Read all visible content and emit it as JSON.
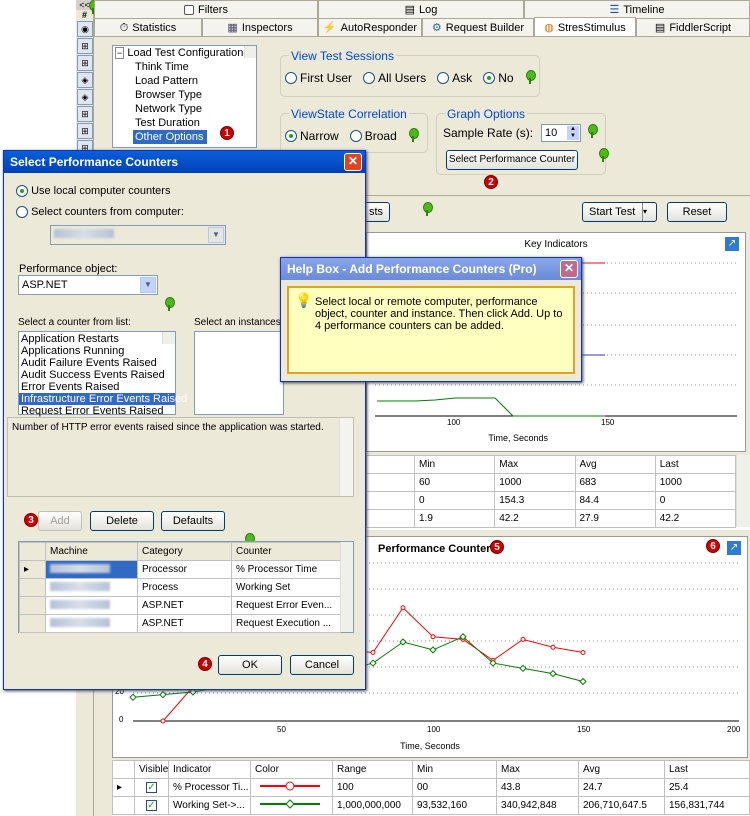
{
  "session_strip": {
    "toggle": "<<",
    "header": "#"
  },
  "top_tabs_row1": [
    {
      "label": "Filters"
    },
    {
      "label": "Log"
    },
    {
      "label": "Timeline"
    }
  ],
  "top_tabs_row2": [
    {
      "label": "Statistics"
    },
    {
      "label": "Inspectors"
    },
    {
      "label": "AutoResponder"
    },
    {
      "label": "Request Builder"
    },
    {
      "label": "StresStimulus",
      "selected": true
    },
    {
      "label": "FiddlerScript"
    }
  ],
  "tree": {
    "root": "Load Test Configuration",
    "items": [
      "Think Time",
      "Load Pattern",
      "Browser Type",
      "Network Type",
      "Test Duration",
      "Other Options"
    ],
    "selected": "Other Options"
  },
  "view_sessions": {
    "title": "View Test Sessions",
    "options": [
      "First User",
      "All Users",
      "Ask",
      "No"
    ],
    "selected": "No"
  },
  "viewstate": {
    "title": "ViewState Correlation",
    "options": [
      "Narrow",
      "Broad"
    ],
    "selected": "Narrow"
  },
  "graph_options": {
    "title": "Graph Options",
    "sample_rate_label": "Sample Rate (s):",
    "sample_rate_value": "10",
    "select_counter_button": "Select  Performance Counter"
  },
  "toolbar": {
    "partial_button": "sts",
    "start_test": "Start Test",
    "reset": "Reset"
  },
  "badges": [
    "1",
    "2",
    "3",
    "4",
    "5",
    "6"
  ],
  "key_chart": {
    "title": "Key Indicators",
    "x_ticks": [
      "100",
      "150"
    ],
    "xlabel": "Time, Seconds"
  },
  "key_table": {
    "headers": [
      "Min",
      "Max",
      "Avg",
      "Last"
    ],
    "rows": [
      [
        "60",
        "1000",
        "683",
        "1000"
      ],
      [
        "0",
        "154.3",
        "84.4",
        "0"
      ],
      [
        "1.9",
        "42.2",
        "27.9",
        "42.2"
      ]
    ]
  },
  "perf_chart": {
    "title": "Performance Counters",
    "xlabel": "Time, Seconds",
    "x_ticks": [
      "50",
      "100",
      "150",
      "200"
    ],
    "y_ticks": [
      "20",
      "0"
    ]
  },
  "chart_data": {
    "type": "line",
    "title": "Performance Counters",
    "xlabel": "Time, Seconds",
    "ylabel": "",
    "xlim": [
      0,
      200
    ],
    "ylim": [
      0,
      60
    ],
    "series": [
      {
        "name": "% Processor Ti...",
        "color": "#ff0000",
        "x": [
          10,
          20,
          30,
          40,
          50,
          60,
          70,
          80,
          90,
          100,
          110,
          120,
          130,
          140,
          150
        ],
        "y": [
          0,
          13,
          20,
          20,
          24,
          29,
          27,
          26,
          43,
          32,
          31,
          23,
          31,
          28,
          26
        ]
      },
      {
        "name": "Working Set->...",
        "color": "#008000",
        "x": [
          0,
          10,
          20,
          30,
          40,
          50,
          60,
          70,
          80,
          90,
          100,
          110,
          120,
          130,
          140,
          150
        ],
        "y": [
          9,
          10,
          11,
          13,
          15,
          16,
          23,
          19,
          22,
          30,
          27,
          32,
          22,
          20,
          18,
          15
        ]
      }
    ]
  },
  "perf_table": {
    "headers": [
      "Visible",
      "Indicator",
      "Color",
      "Range",
      "Min",
      "Max",
      "Avg",
      "Last"
    ],
    "rows": [
      {
        "indicator": "% Processor Ti...",
        "color": "#ff0000",
        "range": "100",
        "min": "00",
        "max": "43.8",
        "avg": "24.7",
        "last": "25.4"
      },
      {
        "indicator": "Working Set->...",
        "color": "#008000",
        "range": "1,000,000,000",
        "min": "93,532,160",
        "max": "340,942,848",
        "avg": "206,710,647.5",
        "last": "156,831,744"
      }
    ]
  },
  "dialog": {
    "title": "Select Performance Counters",
    "use_local": "Use local computer counters",
    "select_from": "Select counters from computer:",
    "perf_object_label": "Performance object:",
    "perf_object_value": "ASP.NET",
    "counter_list_label": "Select a counter from list:",
    "instances_label": "Select an instances f",
    "counters": [
      "Application Restarts",
      "Applications Running",
      "Audit Failure Events Raised",
      "Audit Success Events Raised",
      "Error Events Raised",
      "Infrastructure Error Events Raised",
      "Request Error Events Raised"
    ],
    "selected_counter": "Infrastructure Error Events Raised",
    "description": "Number of HTTP error events raised since the application was started.",
    "add": "Add",
    "delete": "Delete",
    "defaults": "Defaults",
    "table_headers": [
      "Machine",
      "Category",
      "Counter"
    ],
    "table_rows": [
      [
        "Processor",
        "% Processor Time"
      ],
      [
        "Process",
        "Working Set"
      ],
      [
        "ASP.NET",
        "Request Error Even..."
      ],
      [
        "ASP.NET",
        "Request Execution ..."
      ]
    ],
    "ok": "OK",
    "cancel": "Cancel"
  },
  "help": {
    "title": "Help Box - Add Performance Counters (Pro)",
    "text": "Select local or remote computer, performance object, counter and instance. Then click Add. Up to 4 performance counters can be added."
  }
}
